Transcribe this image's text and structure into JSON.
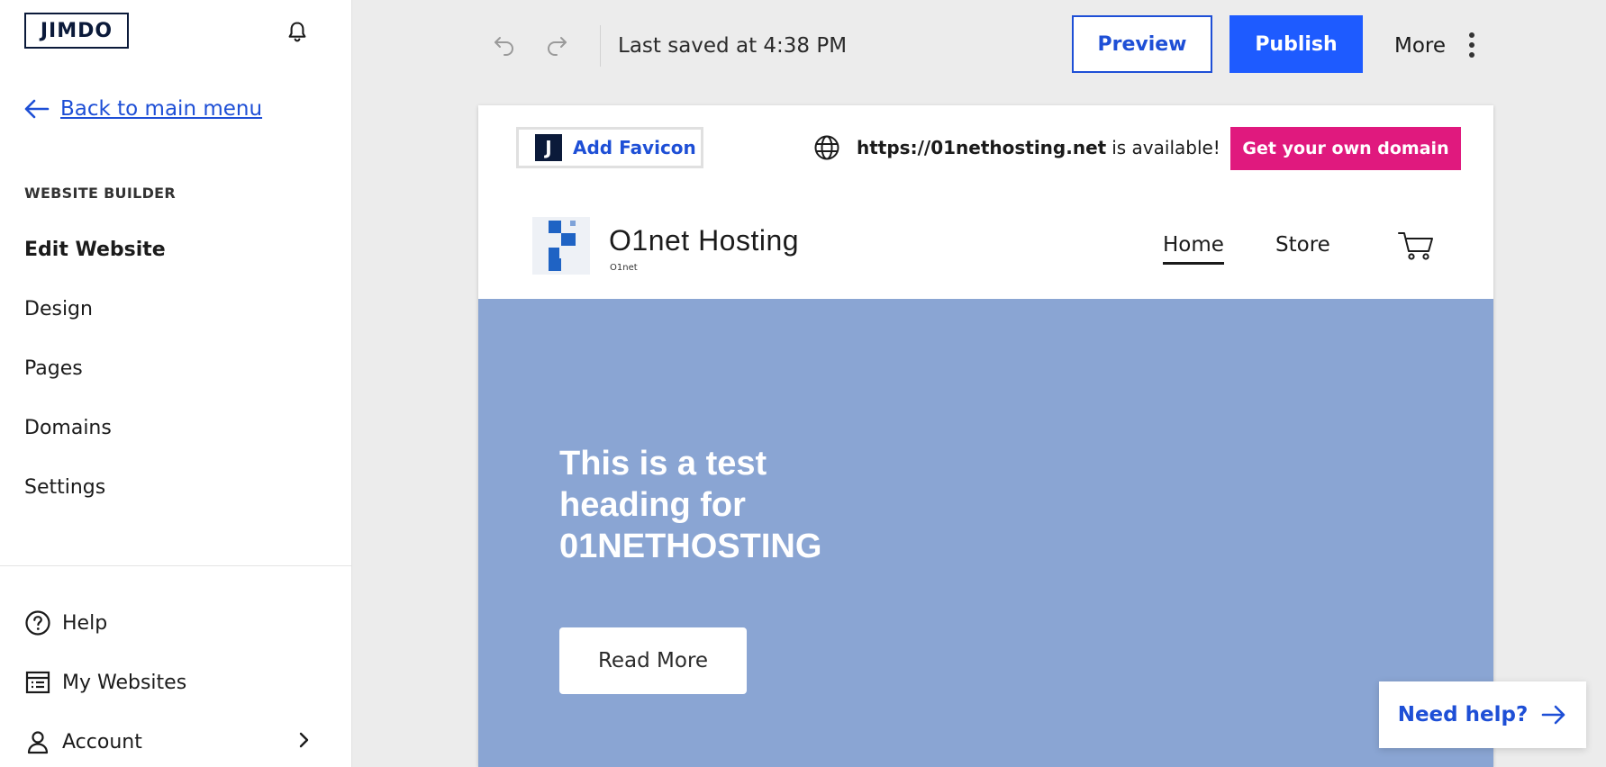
{
  "sidebar": {
    "logo_text": "JIMDO",
    "back_label": "Back to main menu",
    "section_label": "WEBSITE BUILDER",
    "nav": [
      {
        "label": "Edit Website",
        "active": true
      },
      {
        "label": "Design"
      },
      {
        "label": "Pages"
      },
      {
        "label": "Domains"
      },
      {
        "label": "Settings"
      }
    ],
    "footer": [
      {
        "label": "Help",
        "icon": "help-circle-icon"
      },
      {
        "label": "My Websites",
        "icon": "websites-list-icon"
      },
      {
        "label": "Account",
        "icon": "user-icon"
      }
    ]
  },
  "toolbar": {
    "saved_text": "Last saved at 4:38 PM",
    "preview_label": "Preview",
    "publish_label": "Publish",
    "more_label": "More"
  },
  "preview": {
    "favicon_label": "Add Favicon",
    "favicon_glyph": "J",
    "domain_url": "https://01nethosting.net",
    "domain_suffix": "is available!",
    "domain_button": "Get your own domain",
    "site_name": "O1net Hosting",
    "site_tagline": "O1net",
    "menu": {
      "home": "Home",
      "store": "Store"
    },
    "hero_title": "This is a test heading for 01NETHOSTING",
    "hero_button": "Read More"
  },
  "help_widget": {
    "label": "Need help?"
  },
  "colors": {
    "accent_blue": "#1e5bff",
    "link_blue": "#1e4fd6",
    "domain_pink": "#e0197e",
    "hero_bg": "#8aa5d3",
    "logo_navy": "#0b1a3a"
  }
}
